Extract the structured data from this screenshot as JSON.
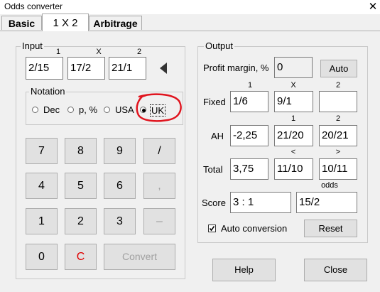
{
  "window": {
    "title": "Odds converter",
    "close_glyph": "✕"
  },
  "tabs": [
    {
      "label": "Basic",
      "active": false
    },
    {
      "label": "1 X 2",
      "active": true
    },
    {
      "label": "Arbitrage",
      "active": false
    }
  ],
  "input": {
    "group_label": "Input",
    "col_labels": [
      "1",
      "X",
      "2"
    ],
    "values": [
      "2/15",
      "17/2",
      "21/1"
    ],
    "notation": {
      "group_label": "Notation",
      "options": [
        "Dec",
        "p, %",
        "USA",
        "UK"
      ],
      "selected": "UK"
    }
  },
  "keypad": {
    "rows": [
      [
        "7",
        "8",
        "9",
        "/"
      ],
      [
        "4",
        "5",
        "6",
        ","
      ],
      [
        "1",
        "2",
        "3",
        "–"
      ]
    ],
    "zero": "0",
    "clear": "C",
    "convert": "Convert"
  },
  "output": {
    "group_label": "Output",
    "profit_margin_label": "Profit margin, %",
    "profit_margin_value": "0",
    "auto_button": "Auto",
    "fixed": {
      "col_labels": [
        "1",
        "X",
        "2"
      ],
      "label": "Fixed",
      "values": [
        "1/6",
        "9/1",
        ""
      ]
    },
    "ah": {
      "col_labels": [
        "1",
        "2"
      ],
      "label": "AH",
      "values": [
        "-2,25",
        "21/20",
        "20/21"
      ]
    },
    "total": {
      "col_labels": [
        "<",
        ">"
      ],
      "label": "Total",
      "values": [
        "3,75",
        "11/10",
        "10/11"
      ]
    },
    "score": {
      "odds_label": "odds",
      "label": "Score",
      "value": "3 : 1",
      "odds_value": "15/2"
    },
    "auto_conversion": {
      "label": "Auto conversion",
      "checked": true
    },
    "reset_button": "Reset"
  },
  "footer": {
    "help_button": "Help",
    "close_button": "Close"
  },
  "colors": {
    "annotation_red": "#e0141e",
    "clear_red": "#e00000"
  }
}
